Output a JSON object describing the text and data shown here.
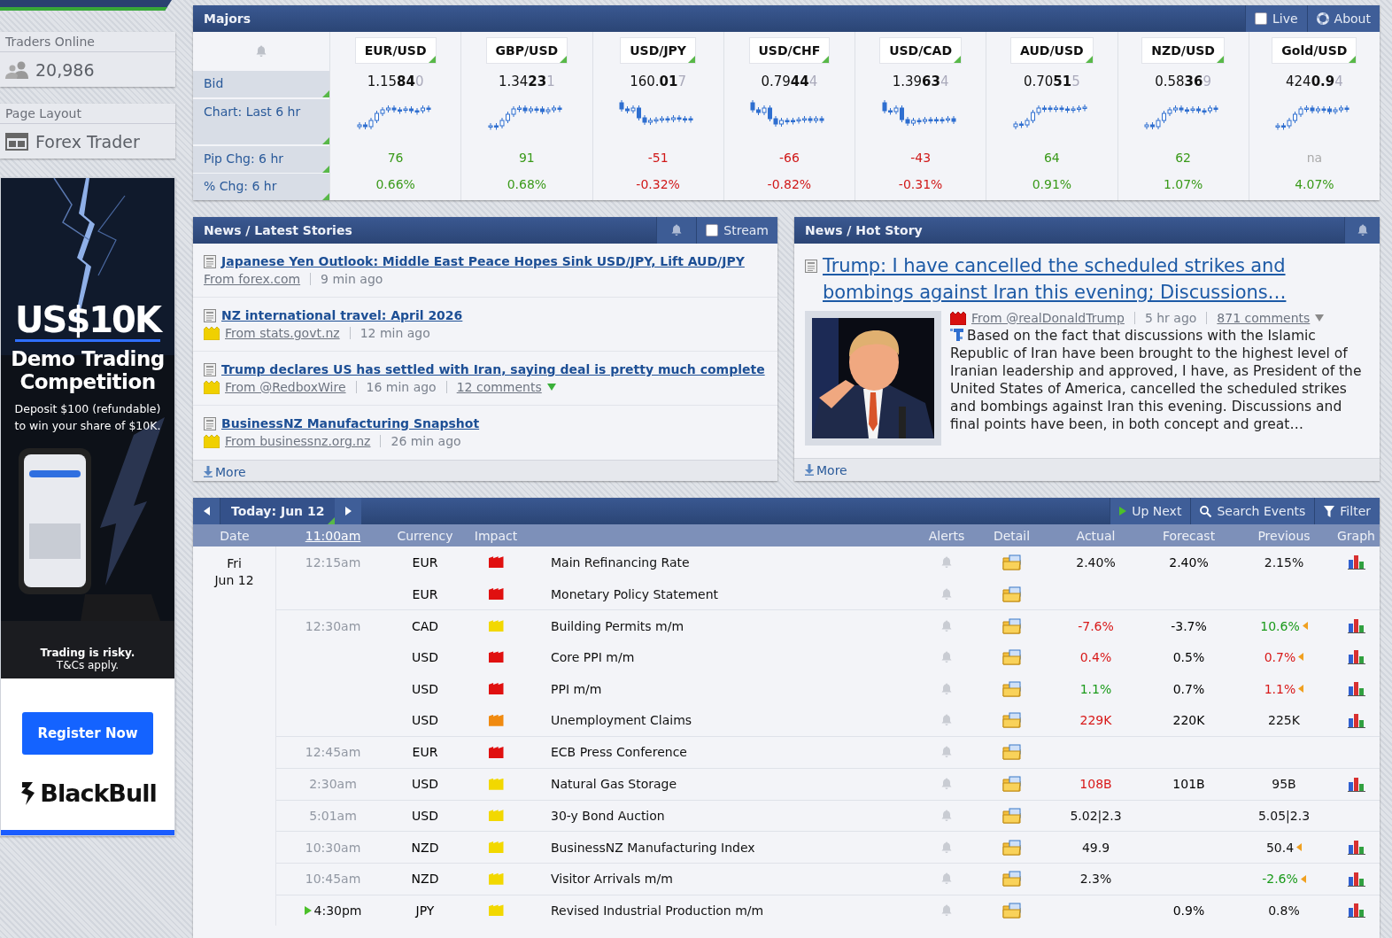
{
  "sidebar": {
    "traders_online": {
      "label": "Traders Online",
      "count": "20,986"
    },
    "page_layout": {
      "label": "Page Layout",
      "value": "Forex Trader"
    },
    "ad": {
      "headline": "US$10K",
      "title": "Demo Trading Competition",
      "offer": "Deposit $100 (refundable) to win your share of $10K.",
      "disclaimer": "Trading is risky.",
      "terms": "T&Cs apply.",
      "button": "Register Now",
      "brand": "BlackBull"
    }
  },
  "majors": {
    "title": "Majors",
    "live": {
      "label": "Live",
      "checked": false
    },
    "about": "About",
    "row_labels": [
      "Bid",
      "Chart: Last 6 hr",
      "Pip Chg: 6 hr",
      "% Chg: 6 hr"
    ],
    "pairs": [
      {
        "kind": "up",
        "symbol": "EUR/USD",
        "bid_main": "1.15",
        "bid_pips": "84",
        "bid_fraction": "0",
        "pip_change": "76",
        "pct_change": "0.66%"
      },
      {
        "kind": "up",
        "symbol": "GBP/USD",
        "bid_main": "1.34",
        "bid_pips": "23",
        "bid_fraction": "1",
        "pip_change": "91",
        "pct_change": "0.68%"
      },
      {
        "kind": "down",
        "symbol": "USD/JPY",
        "bid_main": "160.",
        "bid_pips": "01",
        "bid_fraction": "7",
        "pip_change": "-51",
        "pct_change": "-0.32%"
      },
      {
        "kind": "down",
        "symbol": "USD/CHF",
        "bid_main": "0.79",
        "bid_pips": "44",
        "bid_fraction": "4",
        "pip_change": "-66",
        "pct_change": "-0.82%"
      },
      {
        "kind": "down",
        "symbol": "USD/CAD",
        "bid_main": "1.39",
        "bid_pips": "63",
        "bid_fraction": "4",
        "pip_change": "-43",
        "pct_change": "-0.31%"
      },
      {
        "kind": "up",
        "symbol": "AUD/USD",
        "bid_main": "0.70",
        "bid_pips": "51",
        "bid_fraction": "5",
        "pip_change": "64",
        "pct_change": "0.91%"
      },
      {
        "kind": "up",
        "symbol": "NZD/USD",
        "bid_main": "0.58",
        "bid_pips": "36",
        "bid_fraction": "9",
        "pip_change": "62",
        "pct_change": "1.07%"
      },
      {
        "kind": "na",
        "symbol": "Gold/USD",
        "bid_main": "424",
        "bid_pips": "0.9",
        "bid_fraction": "4",
        "pip_change": "na",
        "pct_change": "4.07%"
      }
    ]
  },
  "latest_news": {
    "title": "News / Latest Stories",
    "stream": {
      "label": "Stream",
      "checked": false
    },
    "stories": [
      {
        "headline": "Japanese Yen Outlook: Middle East Peace Hopes Sink USD/JPY, Lift AUD/JPY",
        "source_flag": false,
        "source": "From forex.com",
        "age": "9 min ago"
      },
      {
        "headline": "NZ international travel: April 2026",
        "source_flag": true,
        "source": "From stats.govt.nz",
        "age": "12 min ago"
      },
      {
        "headline": "Trump declares US has settled with Iran, saying deal is pretty much complete",
        "source_flag": true,
        "source": "From @RedboxWire",
        "age": "16 min ago",
        "comments": "12 comments",
        "comments_new": true
      },
      {
        "headline": "BusinessNZ Manufacturing Snapshot",
        "source_flag": true,
        "source": "From businessnz.org.nz",
        "age": "26 min ago"
      }
    ],
    "more": "More"
  },
  "hot_story": {
    "title": "News / Hot Story",
    "headline": "Trump: I have cancelled the scheduled strikes and bombings against Iran this evening; Discussions…",
    "source_flag": true,
    "source": "From @realDonaldTrump",
    "age": "5 hr ago",
    "comments": "871 comments",
    "comments_new": false,
    "body": "Based on the fact that discussions with the Islamic Republic of Iran have been brought to the highest level of Iranian leadership and approved, I have, as President of the United States of America, cancelled the scheduled strikes and bombings against Iran this evening. Discussions and final points have been, in both concept and great…",
    "more": "More"
  },
  "calendar": {
    "day": "Today: Jun 12",
    "actions": [
      {
        "kind": "next",
        "label": "Up Next"
      },
      {
        "kind": "search",
        "label": "Search Events"
      },
      {
        "kind": "filter",
        "label": "Filter"
      }
    ],
    "columns": [
      "Date",
      "11:00am",
      "Currency",
      "Impact",
      "Alerts",
      "Detail",
      "Actual",
      "Forecast",
      "Previous",
      "Graph"
    ],
    "date_day": "Fri",
    "date": "Jun 12",
    "events": [
      {
        "group_start": true,
        "time": "12:15am",
        "up_next": false,
        "currency": "EUR",
        "impact": {
          "color": "#e01010"
        },
        "event": "Main Refinancing Rate",
        "actual": "2.40%",
        "actual_better": false,
        "actual_worse": false,
        "forecast": "2.40%",
        "previous": "2.15%",
        "previous_better": false,
        "previous_worse": false,
        "revised": false,
        "graph": true
      },
      {
        "group_start": false,
        "up_next": false,
        "currency": "EUR",
        "impact": {
          "color": "#e01010"
        },
        "event": "Monetary Policy Statement",
        "revised": false,
        "graph": false
      },
      {
        "group_start": true,
        "time": "12:30am",
        "up_next": false,
        "currency": "CAD",
        "impact": {
          "color": "#f2d800"
        },
        "event": "Building Permits m/m",
        "actual": "-7.6%",
        "actual_better": false,
        "actual_worse": true,
        "forecast": "-3.7%",
        "previous": "10.6%",
        "previous_better": true,
        "previous_worse": false,
        "revised": true,
        "graph": true
      },
      {
        "group_start": false,
        "up_next": false,
        "currency": "USD",
        "impact": {
          "color": "#e01010"
        },
        "event": "Core PPI m/m",
        "actual": "0.4%",
        "actual_better": false,
        "actual_worse": true,
        "forecast": "0.5%",
        "previous": "0.7%",
        "previous_better": false,
        "previous_worse": true,
        "revised": true,
        "graph": true
      },
      {
        "group_start": false,
        "up_next": false,
        "currency": "USD",
        "impact": {
          "color": "#e01010"
        },
        "event": "PPI m/m",
        "actual": "1.1%",
        "actual_better": true,
        "actual_worse": false,
        "forecast": "0.7%",
        "previous": "1.1%",
        "previous_better": false,
        "previous_worse": true,
        "revised": true,
        "graph": true
      },
      {
        "group_start": false,
        "up_next": false,
        "currency": "USD",
        "impact": {
          "color": "#f08a10"
        },
        "event": "Unemployment Claims",
        "actual": "229K",
        "actual_better": false,
        "actual_worse": true,
        "forecast": "220K",
        "previous": "225K",
        "previous_better": false,
        "previous_worse": false,
        "revised": false,
        "graph": true
      },
      {
        "group_start": true,
        "time": "12:45am",
        "up_next": false,
        "currency": "EUR",
        "impact": {
          "color": "#e01010"
        },
        "event": "ECB Press Conference",
        "revised": false,
        "graph": false
      },
      {
        "group_start": true,
        "time": "2:30am",
        "up_next": false,
        "currency": "USD",
        "impact": {
          "color": "#f2d800"
        },
        "event": "Natural Gas Storage",
        "actual": "108B",
        "actual_better": false,
        "actual_worse": true,
        "forecast": "101B",
        "previous": "95B",
        "previous_better": false,
        "previous_worse": false,
        "revised": false,
        "graph": true
      },
      {
        "group_start": true,
        "time": "5:01am",
        "up_next": false,
        "currency": "USD",
        "impact": {
          "color": "#f2d800"
        },
        "event": "30-y Bond Auction",
        "actual": "5.02|2.3",
        "actual_better": false,
        "actual_worse": false,
        "previous": "5.05|2.3",
        "previous_better": false,
        "previous_worse": false,
        "revised": false,
        "graph": false
      },
      {
        "group_start": true,
        "time": "10:30am",
        "up_next": false,
        "currency": "NZD",
        "impact": {
          "color": "#f2d800"
        },
        "event": "BusinessNZ Manufacturing Index",
        "actual": "49.9",
        "actual_better": false,
        "actual_worse": false,
        "previous": "50.4",
        "previous_better": false,
        "previous_worse": false,
        "revised": true,
        "graph": true
      },
      {
        "group_start": true,
        "time": "10:45am",
        "up_next": false,
        "currency": "NZD",
        "impact": {
          "color": "#f2d800"
        },
        "event": "Visitor Arrivals m/m",
        "actual": "2.3%",
        "actual_better": false,
        "actual_worse": false,
        "previous": "-2.6%",
        "previous_better": true,
        "previous_worse": false,
        "revised": true,
        "graph": true
      },
      {
        "group_start": true,
        "time": "4:30pm",
        "up_next": true,
        "currency": "JPY",
        "impact": {
          "color": "#f2d800"
        },
        "event": "Revised Industrial Production m/m",
        "forecast": "0.9%",
        "previous": "0.8%",
        "previous_better": false,
        "previous_worse": false,
        "revised": false,
        "graph": true
      }
    ]
  }
}
